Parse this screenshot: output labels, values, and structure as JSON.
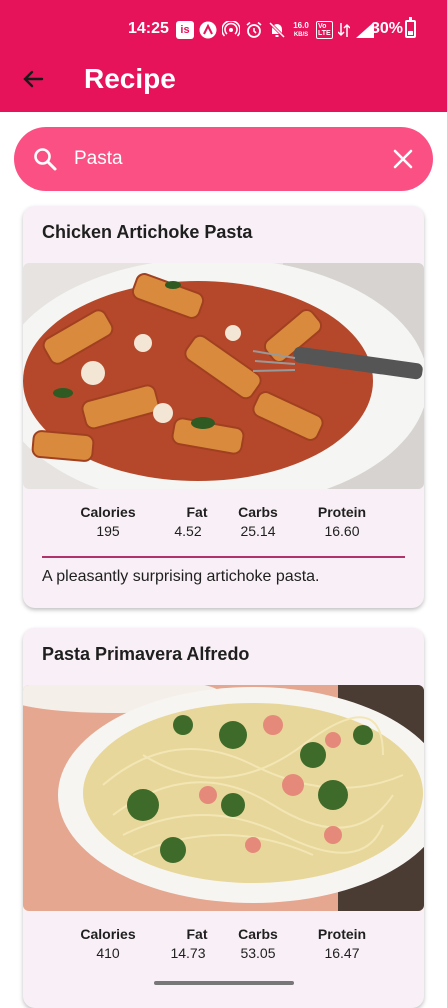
{
  "status_bar": {
    "time": "14:25",
    "battery": "30%",
    "battery_level": 0.3,
    "net_speed": "16.0",
    "net_speed_unit": "KB/S",
    "icons": [
      "is-app-icon",
      "a-app-icon",
      "hotspot-icon",
      "alarm-icon",
      "mute-icon",
      "net-speed-indicator",
      "volte-icon",
      "data-5g-icon",
      "signal-icon",
      "battery-icon"
    ]
  },
  "app_bar": {
    "title": "Recipe",
    "back_icon": "arrow-back-icon"
  },
  "search": {
    "value": "Pasta",
    "icon": "search-icon",
    "clear_icon": "close-icon"
  },
  "stat_labels": [
    "Calories",
    "Fat",
    "Carbs",
    "Protein"
  ],
  "recipes": [
    {
      "title": "Chicken Artichoke Pasta",
      "image": "pasta-bowl-photo",
      "stats": [
        "195",
        "4.52",
        "25.14",
        "16.60"
      ],
      "description": "A pleasantly surprising artichoke pasta."
    },
    {
      "title": "Pasta Primavera Alfredo",
      "image": "spaghetti-broccoli-photo",
      "stats": [
        "410",
        "14.73",
        "53.05",
        "16.47"
      ],
      "description": ""
    }
  ],
  "colors": {
    "primary": "#e6125a",
    "search_bg": "#fb5084",
    "card_bg": "#f8f0f6",
    "divider": "#b0346a"
  }
}
